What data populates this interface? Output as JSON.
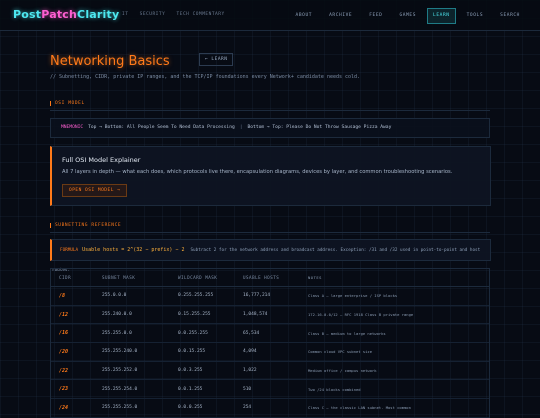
{
  "brand": {
    "part1": "Post",
    "part2": "Patch",
    "part3": "Clarity"
  },
  "crumbs": [
    "IT",
    "SECURITY",
    "TECH COMMENTARY"
  ],
  "nav": [
    {
      "label": "ABOUT",
      "active": false
    },
    {
      "label": "ARCHIVE",
      "active": false
    },
    {
      "label": "FEED",
      "active": false
    },
    {
      "label": "GAMES",
      "active": false
    },
    {
      "label": "LEARN",
      "active": true
    },
    {
      "label": "TOOLS",
      "active": false
    },
    {
      "label": "SEARCH",
      "active": false
    }
  ],
  "page": {
    "title": "Networking Basics",
    "back_tag": "← LEARN",
    "subtitle": "// Subnetting, CIDR, private IP ranges, and the TCP/IP foundations every Network+ candidate needs cold."
  },
  "osi": {
    "section_label": "OSI MODEL",
    "mnemonic_tag": "MNEMONIC",
    "top_down": "Top → Bottom: All People Seem To Need Data Processing",
    "bottom_up": "Bottom → Top: Please Do Not Throw Sausage Pizza Away"
  },
  "card": {
    "title": "Full OSI Model Explainer",
    "description": "All 7 layers in depth — what each does, which protocols live there, encapsulation diagrams, devices by layer, and common troubleshooting scenarios.",
    "button": "OPEN OSI MODEL →"
  },
  "subnet": {
    "section_label": "SUBNETTING REFERENCE",
    "formula_tag": "FORMULA",
    "formula": "Usable hosts = 2^(32 − prefix) − 2",
    "formula_note": "Subtract 2 for the network address and broadcast address. Exception: /31 and /32 used in point-to-point and host routes."
  },
  "table": {
    "headers": [
      "CIDR",
      "SUBNET MASK",
      "WILDCARD MASK",
      "USABLE HOSTS",
      "NOTES"
    ],
    "rows": [
      {
        "cidr": "/8",
        "mask": "255.0.0.0",
        "wildcard": "0.255.255.255",
        "hosts": "16,777,214",
        "notes": "Class A — large enterprise / ISP blocks"
      },
      {
        "cidr": "/12",
        "mask": "255.240.0.0",
        "wildcard": "0.15.255.255",
        "hosts": "1,048,574",
        "notes": "172.16.0.0/12 — RFC 1918 Class B private range"
      },
      {
        "cidr": "/16",
        "mask": "255.255.0.0",
        "wildcard": "0.0.255.255",
        "hosts": "65,534",
        "notes": "Class B — medium to large networks"
      },
      {
        "cidr": "/20",
        "mask": "255.255.240.0",
        "wildcard": "0.0.15.255",
        "hosts": "4,094",
        "notes": "Common cloud VPC subnet size"
      },
      {
        "cidr": "/22",
        "mask": "255.255.252.0",
        "wildcard": "0.0.3.255",
        "hosts": "1,022",
        "notes": "Medium office / campus network"
      },
      {
        "cidr": "/23",
        "mask": "255.255.254.0",
        "wildcard": "0.0.1.255",
        "hosts": "510",
        "notes": "Two /24 blocks combined"
      },
      {
        "cidr": "/24",
        "mask": "255.255.255.0",
        "wildcard": "0.0.0.255",
        "hosts": "254",
        "notes": "Class C — the classic LAN subnet. Most common"
      }
    ]
  }
}
